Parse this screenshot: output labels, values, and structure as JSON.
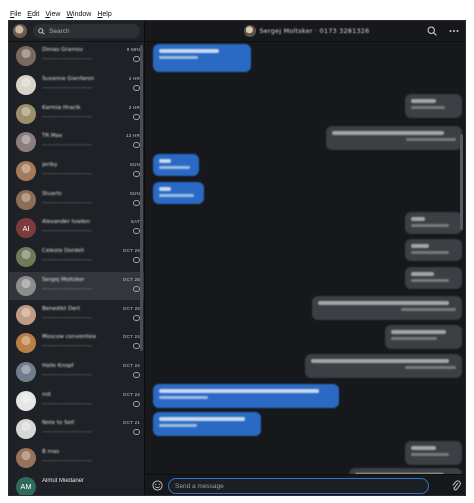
{
  "menubar": [
    "File",
    "Edit",
    "View",
    "Window",
    "Help"
  ],
  "search": {
    "placeholder": "Search"
  },
  "conversations": [
    {
      "name": "Dimas Gramov",
      "time": "9 MIN",
      "avatar_color": "#7a6a5c",
      "active": false
    },
    {
      "name": "Susanna Gianfaron",
      "time": "2 HR",
      "avatar_color": "#d8d2c8",
      "active": false
    },
    {
      "name": "Karmia Hracik",
      "time": "2 HR",
      "avatar_color": "#9c8f6e",
      "active": false
    },
    {
      "name": "TR Max",
      "time": "13 HR",
      "avatar_color": "#8b7e7c",
      "active": false
    },
    {
      "name": "jeriby",
      "time": "SUN",
      "avatar_color": "#a57a5b",
      "active": false
    },
    {
      "name": "Stuarts",
      "time": "SUN",
      "avatar_color": "#8d6d55",
      "active": false
    },
    {
      "name": "Alexander Ivadon",
      "time": "SAT",
      "initials": "AI",
      "avatar_color": "#7c3b3d",
      "active": false
    },
    {
      "name": "Celeste Dordell",
      "time": "OCT 29",
      "avatar_color": "#6e7a5a",
      "active": false
    },
    {
      "name": "Sergej Moltsker",
      "time": "OCT 28",
      "avatar_color": "#8d8d8d",
      "active": true
    },
    {
      "name": "Benedikt Dert",
      "time": "OCT 28",
      "avatar_color": "#c29b83",
      "active": false
    },
    {
      "name": "Moscow conventioa",
      "time": "OCT 24",
      "avatar_color": "#b97f47",
      "active": false
    },
    {
      "name": "Hallo Knopf",
      "time": "OCT 24",
      "avatar_color": "#6f7d8c",
      "active": false
    },
    {
      "name": "mlt",
      "time": "OCT 24",
      "avatar_color": "#e6e6e6",
      "active": false
    },
    {
      "name": "Note to Self",
      "time": "OCT 21",
      "avatar_color": "#d7d7d7",
      "active": false
    },
    {
      "name": "B mas",
      "time": "",
      "avatar_color": "#98725a",
      "active": false
    },
    {
      "name": "Almut Miedaner",
      "time": "",
      "initials": "AM",
      "avatar_color": "#2f6a5c",
      "sharp": true,
      "active": false
    }
  ],
  "header": {
    "title": "Sergej Moltsker · 0173 3281326"
  },
  "composer": {
    "placeholder": "Send a message"
  },
  "colors": {
    "accent": "#2f74d0",
    "incoming_bubble": "#2b6ac4",
    "outgoing_bubble": "#3c3f44",
    "background": "#16181b"
  }
}
